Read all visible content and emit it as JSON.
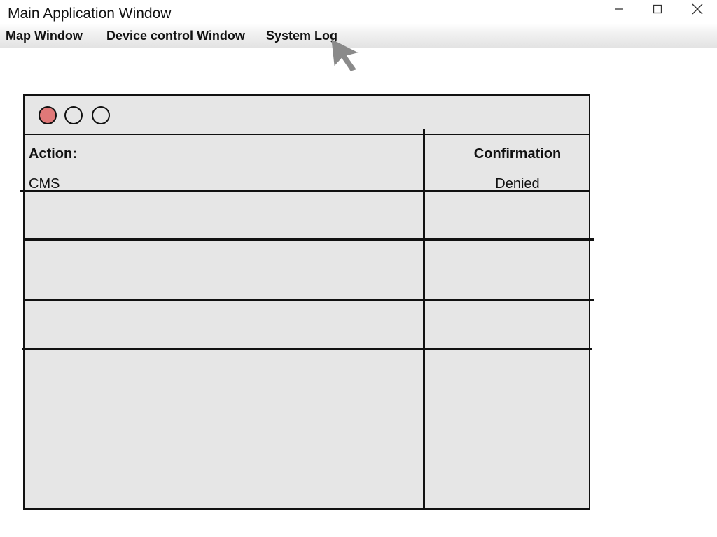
{
  "window": {
    "title": "Main Application Window",
    "controls": {
      "minimize_icon": "minimize-icon",
      "maximize_icon": "maximize-icon",
      "close_icon": "close-icon"
    }
  },
  "menu": {
    "items": [
      {
        "label": "Map Window"
      },
      {
        "label": "Device control Window"
      },
      {
        "label": "System Log"
      }
    ]
  },
  "log_panel": {
    "window_dots": [
      {
        "color": "#e07878",
        "icon": "traffic-light-dot"
      },
      {
        "color": "transparent",
        "icon": "traffic-light-dot"
      },
      {
        "color": "transparent",
        "icon": "traffic-light-dot"
      }
    ],
    "columns": [
      "Action:",
      "Confirmation"
    ],
    "rows": [
      {
        "action": "CMS",
        "confirmation": "Denied"
      },
      {
        "action": "",
        "confirmation": ""
      },
      {
        "action": "",
        "confirmation": ""
      },
      {
        "action": "",
        "confirmation": ""
      },
      {
        "action": "",
        "confirmation": ""
      }
    ]
  },
  "colors": {
    "panel_background": "#e6e6e6",
    "active_dot": "#e07878",
    "cursor": "#8a8a8a"
  }
}
